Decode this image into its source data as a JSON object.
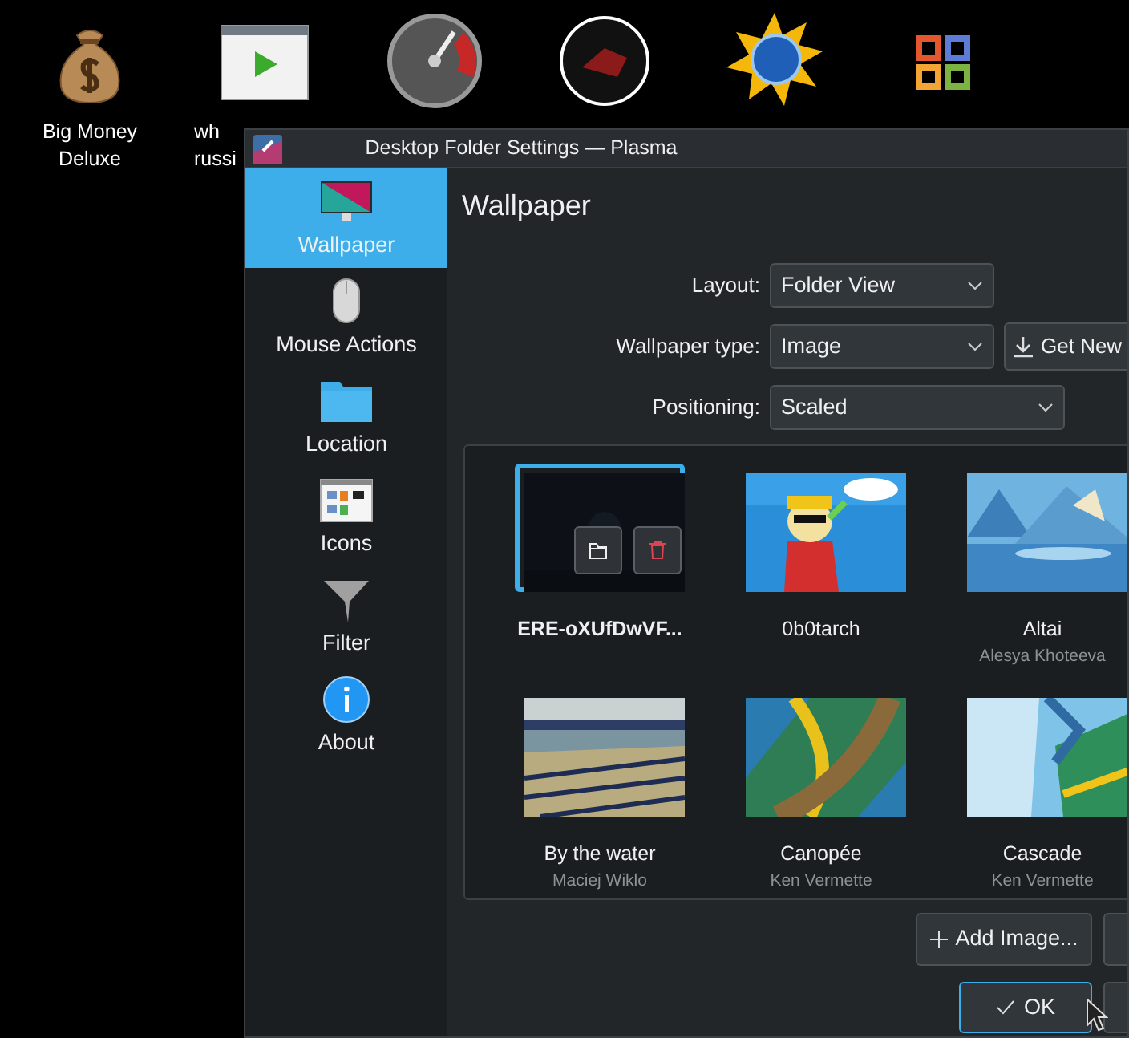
{
  "desktop_icons": [
    {
      "label_lines": [
        "Big Money",
        "Deluxe"
      ]
    },
    {
      "label_lines": [
        "wh",
        "russi"
      ]
    }
  ],
  "window": {
    "title": "Desktop Folder Settings — Plasma"
  },
  "sidebar": {
    "items": [
      {
        "label": "Wallpaper",
        "selected": true
      },
      {
        "label": "Mouse Actions",
        "selected": false
      },
      {
        "label": "Location",
        "selected": false
      },
      {
        "label": "Icons",
        "selected": false
      },
      {
        "label": "Filter",
        "selected": false
      },
      {
        "label": "About",
        "selected": false
      }
    ]
  },
  "page_title": "Wallpaper",
  "form": [
    {
      "label": "Layout:",
      "value": "Folder View"
    },
    {
      "label": "Wallpaper type:",
      "value": "Image"
    },
    {
      "label": "Positioning:",
      "value": "Scaled"
    }
  ],
  "get_new_button": "Get New",
  "wallpapers": [
    {
      "name": "ERE-oXUfDwVF...",
      "selected": true
    },
    {
      "name": "0b0tarch",
      "selected": false
    },
    {
      "name": "Altai",
      "author": "Alesya Khoteeva",
      "selected": false
    },
    {
      "name": "By the water",
      "author": "Maciej Wiklo",
      "selected": false
    },
    {
      "name": "Canopée",
      "author": "Ken Vermette",
      "selected": false
    },
    {
      "name": "Cascade",
      "author": "Ken Vermette",
      "selected": false
    }
  ],
  "add_image_button": "Add Image...",
  "ok_button": "OK"
}
